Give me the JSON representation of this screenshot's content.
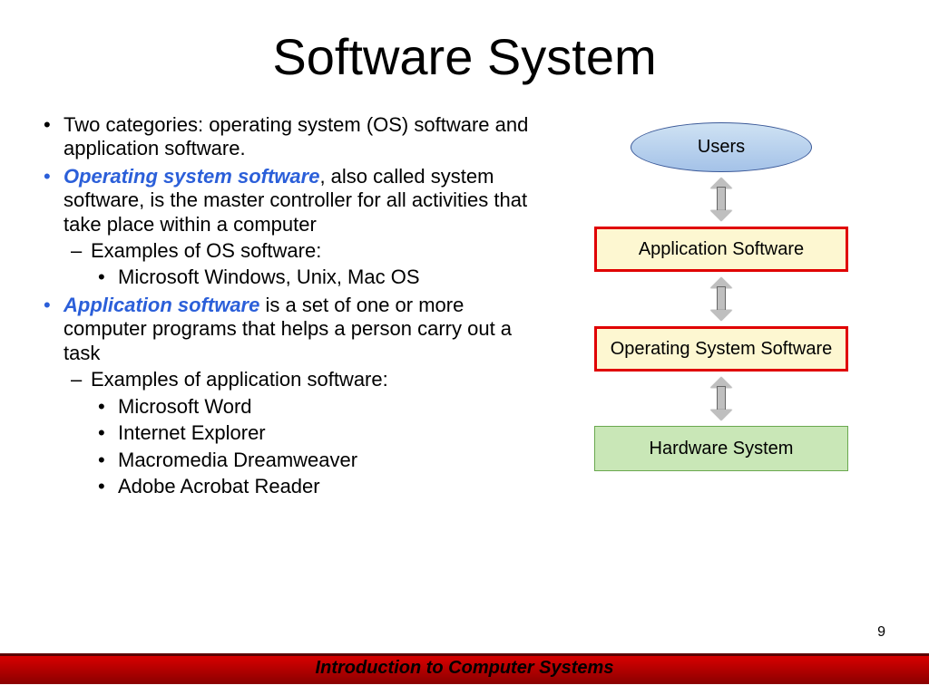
{
  "title": "Software System",
  "bullets": {
    "b1": "Two categories:  operating system (OS) software and application software.",
    "b2_term": "Operating system software",
    "b2_rest": ", also called system software, is the master controller for all activities that take place within a computer",
    "b2_sub": "Examples of OS software:",
    "b2_sub_items": {
      "i0": "Microsoft Windows, Unix, Mac OS"
    },
    "b3_term": "Application software",
    "b3_rest": " is a set of one or more computer programs that helps a person carry out a task",
    "b3_sub": "Examples of application software:",
    "b3_sub_items": {
      "i0": "Microsoft Word",
      "i1": "Internet Explorer",
      "i2": "Macromedia Dreamweaver",
      "i3": "Adobe Acrobat Reader"
    }
  },
  "diagram": {
    "users": "Users",
    "app": "Application Software",
    "os": "Operating System Software",
    "hw": "Hardware System"
  },
  "page_number": "9",
  "footer": "Introduction to Computer Systems"
}
